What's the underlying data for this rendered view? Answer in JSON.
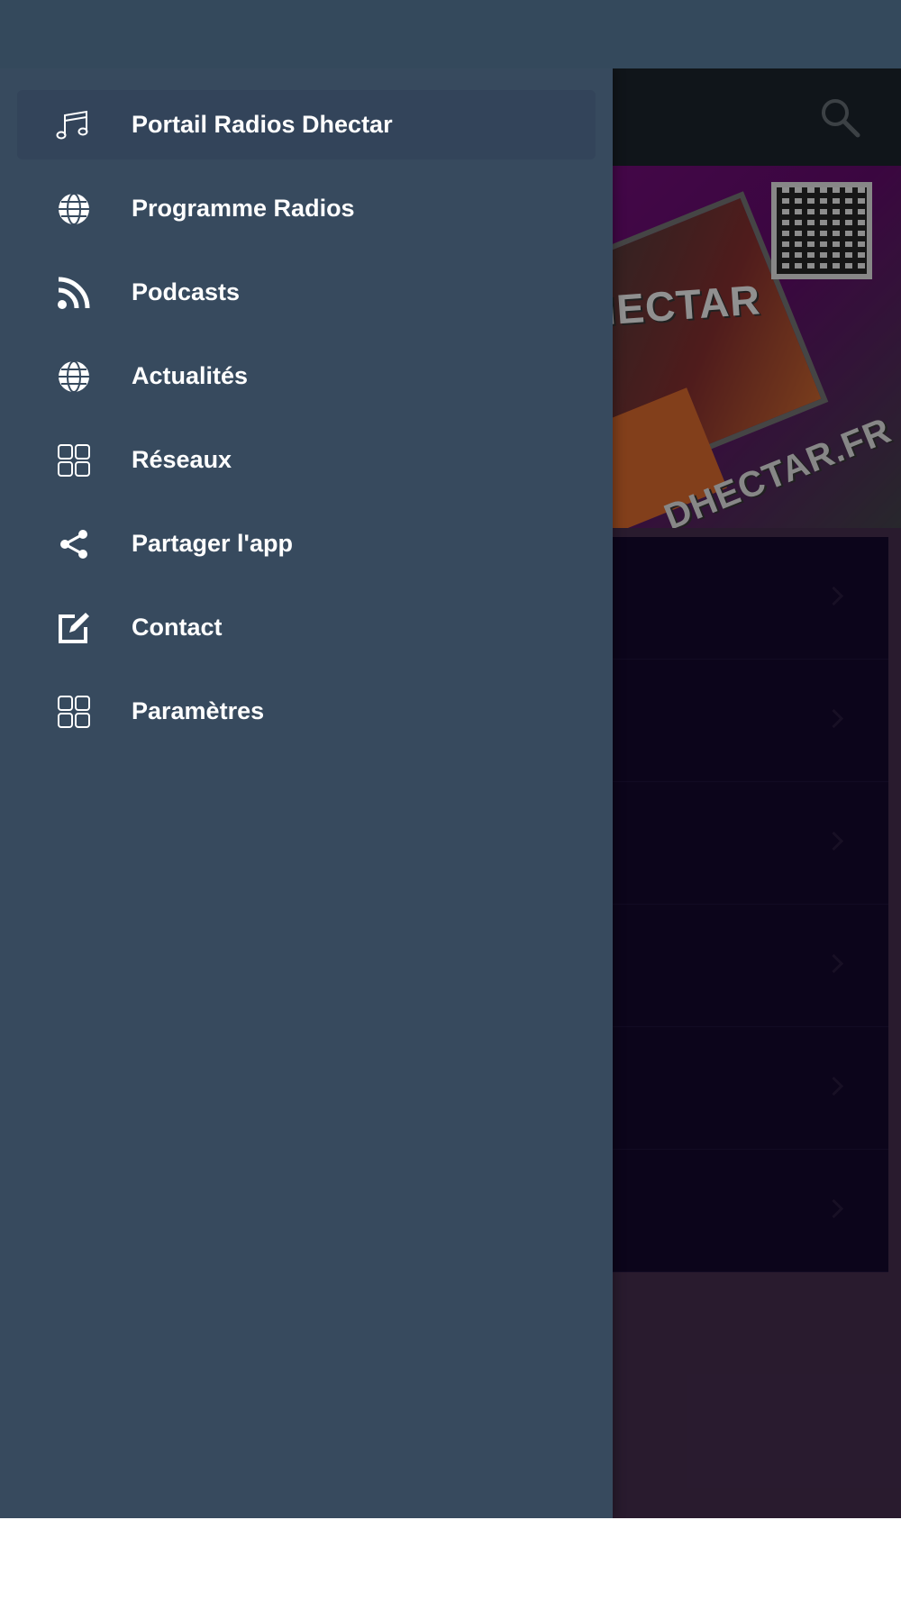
{
  "drawer": {
    "items": [
      {
        "label": "Portail Radios Dhectar",
        "icon": "music-notes-icon",
        "active": true
      },
      {
        "label": "Programme Radios",
        "icon": "globe-icon",
        "active": false
      },
      {
        "label": "Podcasts",
        "icon": "rss-icon",
        "active": false
      },
      {
        "label": "Actualités",
        "icon": "globe-icon",
        "active": false
      },
      {
        "label": "Réseaux",
        "icon": "grid-icon",
        "active": false
      },
      {
        "label": "Partager l'app",
        "icon": "share-icon",
        "active": false
      },
      {
        "label": "Contact",
        "icon": "edit-icon",
        "active": false
      },
      {
        "label": "Paramètres",
        "icon": "grid-icon",
        "active": false
      }
    ]
  },
  "background": {
    "banner_text_1": "HECTAR",
    "banner_text_2": "DHECTAR.FR"
  },
  "colors": {
    "status_bar": "#34495c",
    "drawer": "#374a5e",
    "drawer_active": "#33445a",
    "toolbar": "#1a2128",
    "list_bg": "#13082a"
  }
}
